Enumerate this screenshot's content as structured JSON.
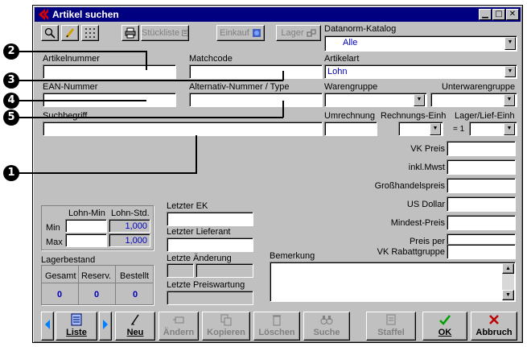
{
  "window": {
    "title": "Artikel suchen",
    "controls": {
      "minimize": "▁",
      "maximize": "□",
      "close": "✕"
    }
  },
  "toolbar": {
    "stueckliste": "Stückliste",
    "einkauf": "Einkauf",
    "lager": "Lager"
  },
  "datanorm": {
    "label": "Datanorm-Katalog",
    "value": "Alle"
  },
  "fields": {
    "artikelnummer": {
      "label": "Artikelnummer",
      "value": ""
    },
    "matchcode": {
      "label": "Matchcode",
      "value": ""
    },
    "artikelart": {
      "label": "Artikelart",
      "value": "Lohn"
    },
    "ean": {
      "label": "EAN-Nummer",
      "value": ""
    },
    "alternativ": {
      "label": "Alternativ-Nummer / Type",
      "value": ""
    },
    "warengruppe": {
      "label": "Warengruppe",
      "value": ""
    },
    "unterwarengruppe": {
      "label": "Unterwarengruppe",
      "value": ""
    },
    "suchbegriff": {
      "label": "Suchbegriff",
      "value": ""
    },
    "umrechnung": {
      "label": "Umrechnung",
      "value": ""
    },
    "rechnungs_einh": {
      "label": "Rechnungs-Einh",
      "value": ""
    },
    "lager_lief_einh": {
      "label": "Lager/Lief-Einh",
      "prefix": "= 1",
      "value": ""
    }
  },
  "prices": [
    {
      "label": "VK Preis",
      "value": ""
    },
    {
      "label": "inkl.Mwst",
      "value": ""
    },
    {
      "label": "Großhandelspreis",
      "value": ""
    },
    {
      "label": "US Dollar",
      "value": ""
    },
    {
      "label": "Mindest-Preis",
      "value": ""
    },
    {
      "label": "Preis per",
      "value": ""
    },
    {
      "label": "VK Rabattgruppe",
      "value": ""
    }
  ],
  "lohn": {
    "col_min": "Lohn-Min",
    "col_std": "Lohn-Std.",
    "row_min": "Min",
    "row_max": "Max",
    "min_std": "1,000",
    "max_std": "1,000"
  },
  "lager": {
    "title": "Lagerbestand",
    "headers": [
      "Gesamt",
      "Reserv.",
      "Bestellt"
    ],
    "values": [
      "0",
      "0",
      "0"
    ]
  },
  "mid": {
    "letzter_ek": "Letzter EK",
    "letzter_lieferant": "Letzter Lieferant",
    "letzte_aenderung": "Letzte Änderung",
    "letzte_preiswartung": "Letzte Preiswartung"
  },
  "bemerkung": {
    "label": "Bemerkung",
    "value": ""
  },
  "bottom": {
    "liste": "Liste",
    "neu": "Neu",
    "aendern": "Ändern",
    "kopieren": "Kopieren",
    "loeschen": "Löschen",
    "suche": "Suche",
    "staffel": "Staffel",
    "ok": "OK",
    "abbruch": "Abbruch"
  },
  "markers": [
    "❶",
    "❷",
    "❸",
    "❹",
    "❺"
  ],
  "marker_labels": [
    "1",
    "2",
    "3",
    "4",
    "5"
  ],
  "colors": {
    "titlebar": "#000080",
    "face": "#c0c0c0",
    "ok_green": "#00a000",
    "abbruch_red": "#c00000",
    "blue_value": "#0000c0"
  }
}
